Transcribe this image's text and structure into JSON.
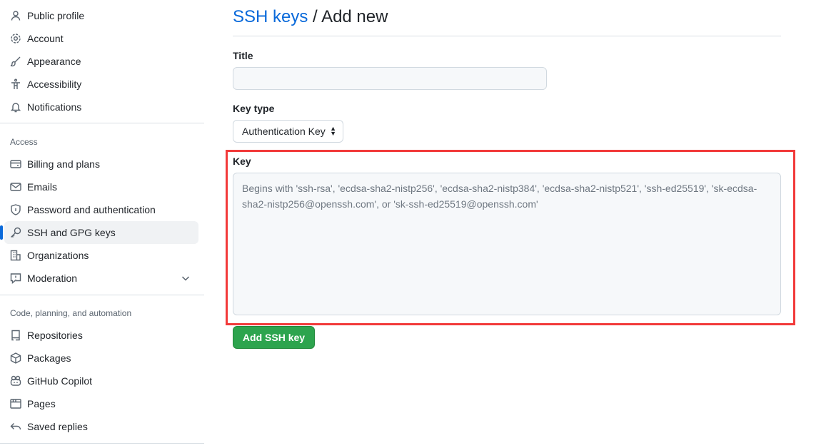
{
  "sidebar": {
    "items": [
      {
        "label": "Public profile",
        "icon": "person-icon"
      },
      {
        "label": "Account",
        "icon": "gear-icon"
      },
      {
        "label": "Appearance",
        "icon": "paintbrush-icon"
      },
      {
        "label": "Accessibility",
        "icon": "accessibility-icon"
      },
      {
        "label": "Notifications",
        "icon": "bell-icon"
      }
    ],
    "access_header": "Access",
    "access_items": [
      {
        "label": "Billing and plans",
        "icon": "credit-card-icon"
      },
      {
        "label": "Emails",
        "icon": "mail-icon"
      },
      {
        "label": "Password and authentication",
        "icon": "shield-lock-icon"
      },
      {
        "label": "SSH and GPG keys",
        "icon": "key-icon",
        "active": true
      },
      {
        "label": "Organizations",
        "icon": "organization-icon"
      },
      {
        "label": "Moderation",
        "icon": "report-icon",
        "expandable": true
      }
    ],
    "code_header": "Code, planning, and automation",
    "code_items": [
      {
        "label": "Repositories",
        "icon": "repo-icon"
      },
      {
        "label": "Packages",
        "icon": "package-icon"
      },
      {
        "label": "GitHub Copilot",
        "icon": "copilot-icon"
      },
      {
        "label": "Pages",
        "icon": "browser-icon"
      },
      {
        "label": "Saved replies",
        "icon": "reply-icon"
      }
    ]
  },
  "main": {
    "breadcrumb_link": "SSH keys",
    "breadcrumb_sep": " / ",
    "breadcrumb_current": "Add new",
    "title_label": "Title",
    "title_value": "",
    "key_type_label": "Key type",
    "key_type_value": "Authentication Key",
    "key_label": "Key",
    "key_placeholder": "Begins with 'ssh-rsa', 'ecdsa-sha2-nistp256', 'ecdsa-sha2-nistp384', 'ecdsa-sha2-nistp521', 'ssh-ed25519', 'sk-ecdsa-sha2-nistp256@openssh.com', or 'sk-ssh-ed25519@openssh.com'",
    "submit_label": "Add SSH key",
    "highlight_color": "#f23a3a",
    "accent_color": "#2da44e"
  }
}
